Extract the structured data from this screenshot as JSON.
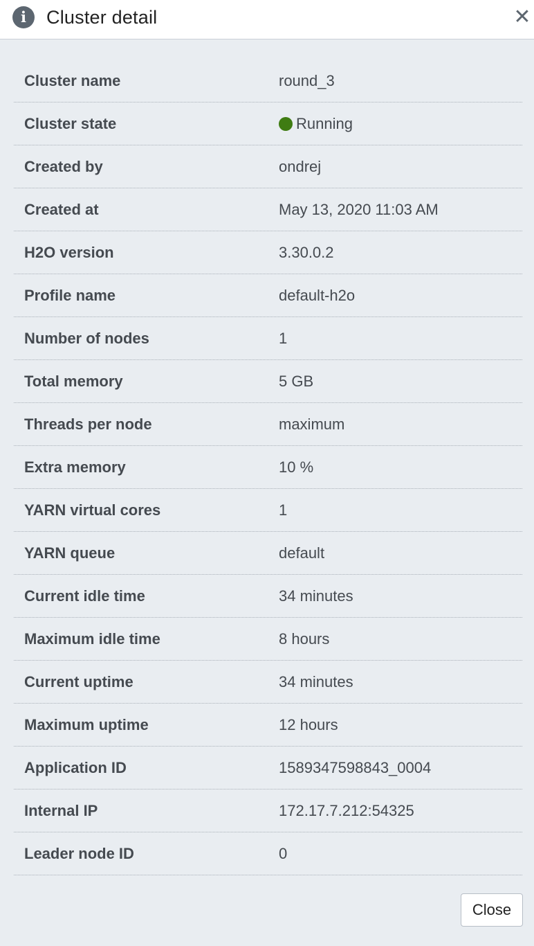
{
  "header": {
    "icon": "info-icon",
    "icon_glyph": "i",
    "title": "Cluster detail",
    "close_glyph": "✕"
  },
  "colors": {
    "running_status": "#3f7c12",
    "info_icon_bg": "#5c6670",
    "dialog_bg": "#e9edf1"
  },
  "rows": [
    {
      "label": "Cluster name",
      "value": "round_3"
    },
    {
      "label": "Cluster state",
      "value": "Running",
      "status": "running"
    },
    {
      "label": "Created by",
      "value": "ondrej"
    },
    {
      "label": "Created at",
      "value": "May 13, 2020 11:03 AM"
    },
    {
      "label": "H2O version",
      "value": "3.30.0.2"
    },
    {
      "label": "Profile name",
      "value": "default-h2o"
    },
    {
      "label": "Number of nodes",
      "value": "1"
    },
    {
      "label": "Total memory",
      "value": "5 GB"
    },
    {
      "label": "Threads per node",
      "value": "maximum"
    },
    {
      "label": "Extra memory",
      "value": "10 %"
    },
    {
      "label": "YARN virtual cores",
      "value": "1"
    },
    {
      "label": "YARN queue",
      "value": "default"
    },
    {
      "label": "Current idle time",
      "value": "34 minutes"
    },
    {
      "label": "Maximum idle time",
      "value": "8 hours"
    },
    {
      "label": "Current uptime",
      "value": "34 minutes"
    },
    {
      "label": "Maximum uptime",
      "value": "12 hours"
    },
    {
      "label": "Application ID",
      "value": "1589347598843_0004"
    },
    {
      "label": "Internal IP",
      "value": "172.17.7.212:54325"
    },
    {
      "label": "Leader node ID",
      "value": "0"
    }
  ],
  "footer": {
    "close_label": "Close"
  }
}
